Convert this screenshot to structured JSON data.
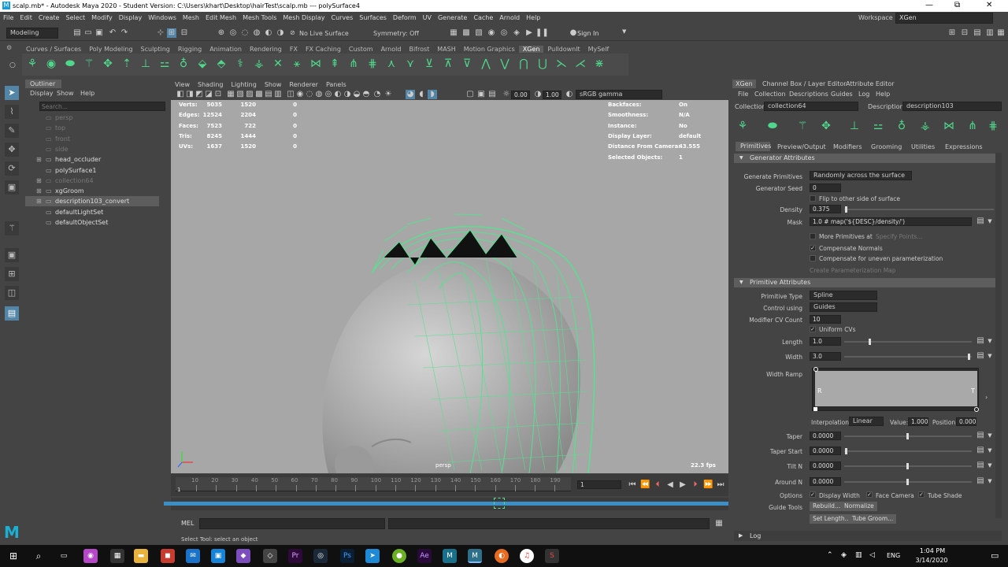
{
  "window": {
    "title": "scalp.mb* - Autodesk Maya 2020 - Student Version: C:\\Users\\khart\\Desktop\\hairTest\\scalp.mb  ---  polySurface4",
    "minimize": "—",
    "maximize": "⧉",
    "close": "✕"
  },
  "menubar": [
    "File",
    "Edit",
    "Create",
    "Select",
    "Modify",
    "Display",
    "Windows",
    "Mesh",
    "Edit Mesh",
    "Mesh Tools",
    "Mesh Display",
    "Curves",
    "Surfaces",
    "Deform",
    "UV",
    "Generate",
    "Cache",
    "Arnold",
    "Help"
  ],
  "workspace": {
    "label": "Workspace :",
    "value": "XGen"
  },
  "statusline": {
    "mode": "Modeling",
    "live_surface": "No Live Surface",
    "symmetry": "Symmetry: Off",
    "sign_in": "Sign In"
  },
  "shelf_tabs": [
    "Curves / Surfaces",
    "Poly Modeling",
    "Sculpting",
    "Rigging",
    "Animation",
    "Rendering",
    "FX",
    "FX Caching",
    "Custom",
    "Arnold",
    "Bifrost",
    "MASH",
    "Motion Graphics",
    "XGen",
    "Pulldownlt",
    "MySelf"
  ],
  "shelf_active": "XGen",
  "outliner": {
    "title": "Outliner",
    "menu": [
      "Display",
      "Show",
      "Help"
    ],
    "search_placeholder": "Search...",
    "items": [
      {
        "label": "persp",
        "dim": true,
        "expand": ""
      },
      {
        "label": "top",
        "dim": true,
        "expand": ""
      },
      {
        "label": "front",
        "dim": true,
        "expand": ""
      },
      {
        "label": "side",
        "dim": true,
        "expand": ""
      },
      {
        "label": "head_occluder",
        "dim": false,
        "expand": "⊞"
      },
      {
        "label": "polySurface1",
        "dim": false,
        "expand": ""
      },
      {
        "label": "collection64",
        "dim": true,
        "expand": "⊞"
      },
      {
        "label": "xgGroom",
        "dim": false,
        "expand": "⊞"
      },
      {
        "label": "description103_convert",
        "dim": false,
        "expand": "⊞"
      },
      {
        "label": "defaultLightSet",
        "dim": false,
        "expand": ""
      },
      {
        "label": "defaultObjectSet",
        "dim": false,
        "expand": ""
      }
    ]
  },
  "viewport": {
    "menu": [
      "View",
      "Shading",
      "Lighting",
      "Show",
      "Renderer",
      "Panels"
    ],
    "field1": "0.00",
    "field2": "1.00",
    "color_space": "sRGB gamma",
    "stats": [
      {
        "label": "Verts:",
        "a": "5035",
        "b": "1520",
        "c": "0"
      },
      {
        "label": "Edges:",
        "a": "12524",
        "b": "2204",
        "c": "0"
      },
      {
        "label": "Faces:",
        "a": "7523",
        "b": "722",
        "c": "0"
      },
      {
        "label": "Tris:",
        "a": "8245",
        "b": "1444",
        "c": "0"
      },
      {
        "label": "UVs:",
        "a": "1637",
        "b": "1520",
        "c": "0"
      }
    ],
    "info": [
      {
        "label": "Backfaces:",
        "value": "On"
      },
      {
        "label": "Smoothness:",
        "value": "N/A"
      },
      {
        "label": "Instance:",
        "value": "No"
      },
      {
        "label": "Display Layer:",
        "value": "default"
      },
      {
        "label": "Distance From Camera:",
        "value": "43.555"
      },
      {
        "label": "Selected Objects:",
        "value": "1"
      }
    ],
    "camera": "persp",
    "fps": "22.3 fps"
  },
  "timeline": {
    "ticks": [
      "10",
      "20",
      "30",
      "40",
      "50",
      "60",
      "70",
      "80",
      "90",
      "100",
      "110",
      "120",
      "130",
      "140",
      "150",
      "160",
      "170",
      "180",
      "190"
    ],
    "start": "1",
    "current": "1"
  },
  "mel": {
    "label": "MEL",
    "help": "Select Tool: select an object"
  },
  "right_panel": {
    "tabs": [
      "XGen",
      "Channel Box / Layer Editor",
      "Attribute Editor"
    ],
    "menu": [
      "File",
      "Collection",
      "Descriptions",
      "Guides",
      "Log",
      "Help"
    ],
    "collection_label": "Collection",
    "collection": "collection64",
    "description_label": "Description",
    "description": "description103",
    "subtabs": [
      "Primitives",
      "Preview/Output",
      "Modifiers",
      "Grooming",
      "Utilities",
      "Expressions"
    ],
    "gen_section": "Generator Attributes",
    "generate_primitives_label": "Generate Primitives",
    "generate_primitives": "Randomly across the surface",
    "generator_seed_label": "Generator Seed",
    "generator_seed": "0",
    "flip_label": "Flip to other side of surface",
    "density_label": "Density",
    "density": "0.375",
    "mask_label": "Mask",
    "mask": "1.0 # map('${DESC}/density/')",
    "more_primitives": "More Primitives at",
    "specify_points": "Specify Points...",
    "compensate_normals": "Compensate Normals",
    "compensate_uneven": "Compensate for uneven parameterization",
    "create_param_map": "Create Parameterization Map",
    "prim_section": "Primitive Attributes",
    "primitive_type_label": "Primitive Type",
    "primitive_type": "Spline",
    "control_using_label": "Control using",
    "control_using": "Guides",
    "modifier_cv_label": "Modifier CV Count",
    "modifier_cv": "10",
    "uniform_cvs": "Uniform CVs",
    "length_label": "Length",
    "length": "1.0",
    "width_label": "Width",
    "width": "3.0",
    "width_ramp_label": "Width Ramp",
    "ramp_r": "R",
    "ramp_t": "T",
    "interp_label": "Interpolation:",
    "interp": "Linear",
    "value_label": "Value:",
    "value": "1.000",
    "position_label": "Position:",
    "position": "0.000",
    "taper_label": "Taper",
    "taper": "0.0000",
    "taper_start_label": "Taper Start",
    "taper_start": "0.0000",
    "tilt_n_label": "Tilt N",
    "tilt_n": "0.0000",
    "around_n_label": "Around N",
    "around_n": "0.0000",
    "options_label": "Options",
    "display_width": "Display Width",
    "face_camera": "Face Camera",
    "tube_shade": "Tube Shade",
    "guide_tools_label": "Guide Tools",
    "rebuild": "Rebuild...",
    "normalize": "Normalize",
    "set_length": "Set Length...",
    "tube_groom": "Tube Groom...",
    "log": "Log"
  },
  "taskbar": {
    "lang": "ENG",
    "time": "1:04 PM",
    "date": "3/14/2020"
  }
}
